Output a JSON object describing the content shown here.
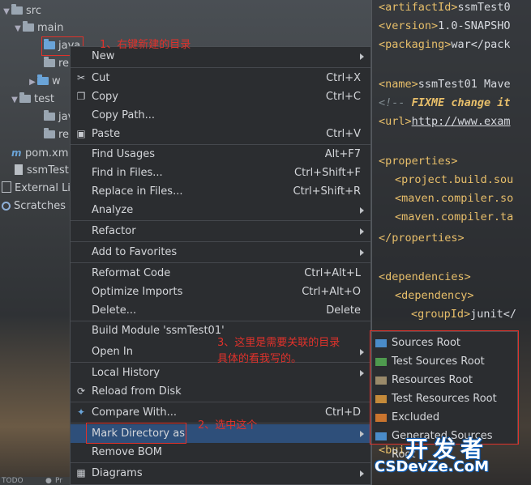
{
  "tree": {
    "items": [
      {
        "label": "src"
      },
      {
        "label": "main"
      },
      {
        "label": "java"
      },
      {
        "label": "re"
      },
      {
        "label": "w"
      },
      {
        "label": "test"
      },
      {
        "label": "jav"
      },
      {
        "label": "re"
      },
      {
        "label": "pom.xm"
      },
      {
        "label": "ssmTest"
      },
      {
        "label": "External Lib"
      },
      {
        "label": "Scratches a"
      }
    ]
  },
  "editor": {
    "lines": [
      {
        "open": "<artifactId>",
        "text": "ssmTest0"
      },
      {
        "open": "<version>",
        "text": "1.0-SNAPSHO"
      },
      {
        "open": "<packaging>",
        "text": "war</pack"
      },
      {
        "open": "<name>",
        "text": "ssmTest01 Mave"
      },
      {
        "comment": "<!-- ",
        "fixme": "FIXME change it"
      },
      {
        "open": "<url>",
        "text": "http://www.exam"
      },
      {
        "open": "<properties>",
        "text": ""
      },
      {
        "open": "<project.build.sou",
        "text": ""
      },
      {
        "open": "<maven.compiler.so",
        "text": ""
      },
      {
        "open": "<maven.compiler.ta",
        "text": ""
      },
      {
        "open": "</properties>",
        "text": ""
      },
      {
        "open": "<dependencies>",
        "text": ""
      },
      {
        "open": "<dependency>",
        "text": ""
      },
      {
        "open": "<groupId>",
        "text": "junit</"
      },
      {
        "open": "<bui",
        "text": ""
      }
    ]
  },
  "menu": {
    "items": [
      {
        "label": "New",
        "shortcut": "",
        "submenu": true
      },
      {
        "label": "Cut",
        "shortcut": "Ctrl+X",
        "icon": "scissors-icon"
      },
      {
        "label": "Copy",
        "shortcut": "Ctrl+C",
        "icon": "copy-icon"
      },
      {
        "label": "Copy Path...",
        "shortcut": ""
      },
      {
        "label": "Paste",
        "shortcut": "Ctrl+V",
        "icon": "clipboard-icon"
      },
      {
        "label": "Find Usages",
        "shortcut": "Alt+F7"
      },
      {
        "label": "Find in Files...",
        "shortcut": "Ctrl+Shift+F"
      },
      {
        "label": "Replace in Files...",
        "shortcut": "Ctrl+Shift+R"
      },
      {
        "label": "Analyze",
        "shortcut": "",
        "submenu": true
      },
      {
        "label": "Refactor",
        "shortcut": "",
        "submenu": true
      },
      {
        "label": "Add to Favorites",
        "shortcut": "",
        "submenu": true
      },
      {
        "label": "Reformat Code",
        "shortcut": "Ctrl+Alt+L"
      },
      {
        "label": "Optimize Imports",
        "shortcut": "Ctrl+Alt+O"
      },
      {
        "label": "Delete...",
        "shortcut": "Delete"
      },
      {
        "label": "Build Module 'ssmTest01'",
        "shortcut": ""
      },
      {
        "label": "Open In",
        "shortcut": "",
        "submenu": true
      },
      {
        "label": "Local History",
        "shortcut": "",
        "submenu": true
      },
      {
        "label": "Reload from Disk",
        "shortcut": "",
        "icon": "reload-icon"
      },
      {
        "label": "Compare With...",
        "shortcut": "Ctrl+D",
        "icon": "compare-icon"
      },
      {
        "label": "Mark Directory as",
        "shortcut": "",
        "submenu": true
      },
      {
        "label": "Remove BOM",
        "shortcut": ""
      },
      {
        "label": "Diagrams",
        "shortcut": "",
        "submenu": true,
        "icon": "diagram-icon"
      }
    ]
  },
  "submenu": {
    "items": [
      {
        "label": "Sources Root",
        "color": "#4a8cc9"
      },
      {
        "label": "Test Sources Root",
        "color": "#4e9a4e"
      },
      {
        "label": "Resources Root",
        "color": "#9a8a6a"
      },
      {
        "label": "Test Resources Root",
        "color": "#c48a3a"
      },
      {
        "label": "Excluded",
        "color": "#c9742e"
      },
      {
        "label": "Generated Sources Root",
        "color": "#4a8cc9"
      }
    ]
  },
  "annotations": {
    "a1": "1、右键新建的目录",
    "a2": "2、选中这个",
    "a3_line1": "3、这里是需要关联的目录",
    "a3_line2": "具体的看我写的。"
  },
  "bottom": {
    "todo": "TODO",
    "p": "Pr"
  },
  "watermark": {
    "line1": "开发者",
    "line2": "CSDevZe.CoM"
  }
}
